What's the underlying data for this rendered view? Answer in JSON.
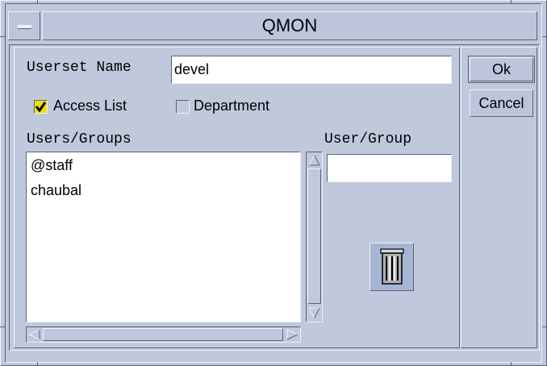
{
  "window": {
    "title": "QMON"
  },
  "form": {
    "userset_name_label": "Userset Name",
    "userset_name_value": "devel",
    "access_list_label": "Access List",
    "access_list_checked": true,
    "department_label": "Department",
    "department_checked": false
  },
  "users_groups": {
    "label": "Users/Groups",
    "items": [
      "@staff",
      "chaubal"
    ]
  },
  "user_group_entry": {
    "label": "User/Group",
    "value": ""
  },
  "buttons": {
    "ok_label": "Ok",
    "cancel_label": "Cancel"
  },
  "icons": {
    "window_menu": "window-menu-icon",
    "trash": "trash-can-icon",
    "scroll_up": "arrow-up-icon",
    "scroll_down": "arrow-down-icon",
    "scroll_left": "arrow-left-icon",
    "scroll_right": "arrow-right-icon"
  },
  "colors": {
    "background": "#c0c8dc",
    "checkbox_fill": "#f0e000",
    "field_background": "#ffffff"
  }
}
